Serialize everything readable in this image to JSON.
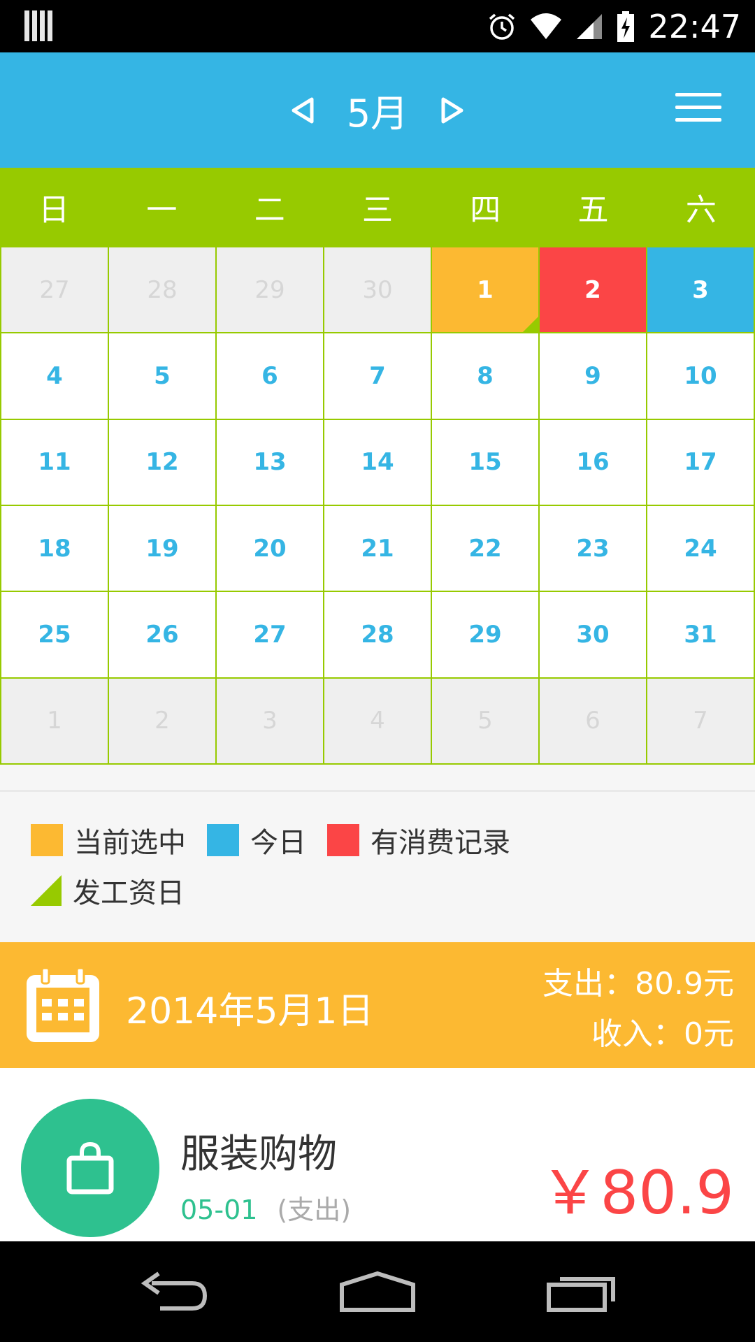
{
  "status_bar": {
    "time": "22:47"
  },
  "header": {
    "month_title": "5月"
  },
  "weekdays": [
    "日",
    "一",
    "二",
    "三",
    "四",
    "五",
    "六"
  ],
  "calendar": {
    "cells": [
      {
        "day": "27",
        "state": "other"
      },
      {
        "day": "28",
        "state": "other"
      },
      {
        "day": "29",
        "state": "other"
      },
      {
        "day": "30",
        "state": "other"
      },
      {
        "day": "1",
        "state": "selected",
        "payday": true
      },
      {
        "day": "2",
        "state": "expense"
      },
      {
        "day": "3",
        "state": "today"
      },
      {
        "day": "4",
        "state": "normal"
      },
      {
        "day": "5",
        "state": "normal"
      },
      {
        "day": "6",
        "state": "normal"
      },
      {
        "day": "7",
        "state": "normal"
      },
      {
        "day": "8",
        "state": "normal"
      },
      {
        "day": "9",
        "state": "normal"
      },
      {
        "day": "10",
        "state": "normal"
      },
      {
        "day": "11",
        "state": "normal"
      },
      {
        "day": "12",
        "state": "normal"
      },
      {
        "day": "13",
        "state": "normal"
      },
      {
        "day": "14",
        "state": "normal"
      },
      {
        "day": "15",
        "state": "normal"
      },
      {
        "day": "16",
        "state": "normal"
      },
      {
        "day": "17",
        "state": "normal"
      },
      {
        "day": "18",
        "state": "normal"
      },
      {
        "day": "19",
        "state": "normal"
      },
      {
        "day": "20",
        "state": "normal"
      },
      {
        "day": "21",
        "state": "normal"
      },
      {
        "day": "22",
        "state": "normal"
      },
      {
        "day": "23",
        "state": "normal"
      },
      {
        "day": "24",
        "state": "normal"
      },
      {
        "day": "25",
        "state": "normal"
      },
      {
        "day": "26",
        "state": "normal"
      },
      {
        "day": "27",
        "state": "normal"
      },
      {
        "day": "28",
        "state": "normal"
      },
      {
        "day": "29",
        "state": "normal"
      },
      {
        "day": "30",
        "state": "normal"
      },
      {
        "day": "31",
        "state": "normal"
      },
      {
        "day": "1",
        "state": "other"
      },
      {
        "day": "2",
        "state": "other"
      },
      {
        "day": "3",
        "state": "other"
      },
      {
        "day": "4",
        "state": "other"
      },
      {
        "day": "5",
        "state": "other"
      },
      {
        "day": "6",
        "state": "other"
      },
      {
        "day": "7",
        "state": "other"
      }
    ]
  },
  "legend": {
    "selected": "当前选中",
    "today": "今日",
    "expense": "有消费记录",
    "payday": "发工资日"
  },
  "selected_date": {
    "date": "2014年5月1日",
    "expense_label": "支出：80.9元",
    "income_label": "收入：0元"
  },
  "record": {
    "title": "服装购物",
    "date": "05-01",
    "type": "(支出)",
    "amount": "￥80.9"
  },
  "colors": {
    "header": "#35b5e4",
    "weekday_bar": "#97ca00",
    "selected": "#fcb932",
    "expense": "#fb4546",
    "today": "#35b5e4",
    "record_icon": "#2ec18f"
  },
  "icons": {
    "calendar": "calendar-icon",
    "shopping_bag": "shopping-bag-icon",
    "menu": "hamburger-menu-icon"
  }
}
